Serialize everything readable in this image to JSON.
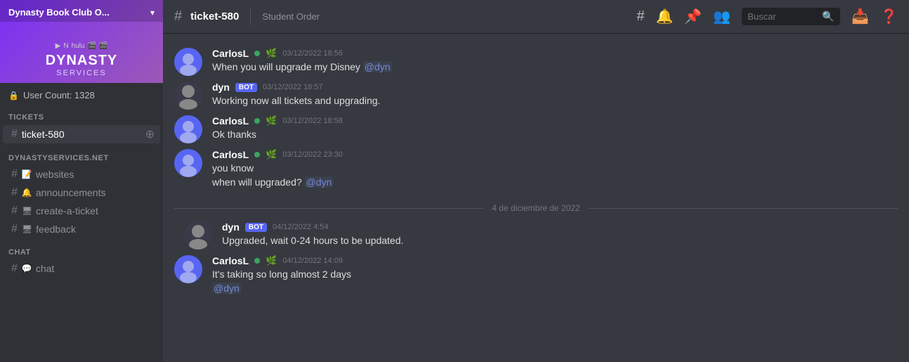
{
  "server": {
    "name": "Dynasty Book Club O...",
    "brand": "DYNASTY",
    "sub": "SERVICES",
    "logos": "🎬 N hulu 🎬 🎬",
    "user_count_label": "User Count: 1328"
  },
  "sidebar": {
    "sections": [
      {
        "label": "TICKETS",
        "channels": [
          {
            "id": "ticket-580",
            "name": "ticket-580",
            "emoji": "",
            "active": true
          }
        ]
      },
      {
        "label": "DYNASTYSERVICES.NET",
        "channels": [
          {
            "id": "websites",
            "name": "websites",
            "emoji": "📝"
          },
          {
            "id": "announcements",
            "name": "announcements",
            "emoji": "🔔"
          },
          {
            "id": "create-a-ticket",
            "name": "create-a-ticket",
            "emoji": "🖥"
          },
          {
            "id": "feedback",
            "name": "feedback",
            "emoji": "🖥"
          }
        ]
      },
      {
        "label": "CHAT",
        "channels": [
          {
            "id": "chat",
            "name": "chat",
            "emoji": "💬"
          }
        ]
      }
    ]
  },
  "topbar": {
    "channel": "ticket-580",
    "subtitle": "Student Order",
    "search_placeholder": "Buscar"
  },
  "messages": [
    {
      "id": "msg1",
      "author": "CarlosL",
      "author_type": "carlosl",
      "status": "online",
      "boost": true,
      "timestamp": "03/12/2022 18:56",
      "lines": [
        "When you will upgrade my Disney @dyn"
      ],
      "mention": "@dyn"
    },
    {
      "id": "msg2",
      "author": "dyn",
      "author_type": "dyn",
      "status": "online",
      "badge": "BOT",
      "timestamp": "03/12/2022 18:57",
      "lines": [
        "Working now all tickets and upgrading."
      ],
      "mention": ""
    },
    {
      "id": "msg3",
      "author": "CarlosL",
      "author_type": "carlosl",
      "status": "online",
      "boost": true,
      "timestamp": "03/12/2022 18:58",
      "lines": [
        "Ok thanks"
      ],
      "mention": ""
    },
    {
      "id": "msg4",
      "author": "CarlosL",
      "author_type": "carlosl",
      "status": "online",
      "boost": true,
      "timestamp": "03/12/2022 23:30",
      "lines": [
        "you know",
        "when will upgraded? @dyn"
      ],
      "mention": "@dyn"
    }
  ],
  "date_divider": "4 de diciembre de 2022",
  "messages2": [
    {
      "id": "msg5",
      "author": "dyn",
      "author_type": "dyn",
      "status": "online",
      "badge": "BOT",
      "timestamp": "04/12/2022 4:54",
      "lines": [
        "Upgraded, wait 0-24 hours to be updated."
      ],
      "mention": ""
    },
    {
      "id": "msg6",
      "author": "CarlosL",
      "author_type": "carlosl",
      "status": "online",
      "boost": true,
      "timestamp": "04/12/2022 14:09",
      "lines": [
        "It's taking so long almost 2 days",
        "@dyn"
      ],
      "mention": "@dyn"
    }
  ],
  "icons": {
    "hash": "#",
    "lock": "🔒",
    "chevron_down": "▾",
    "add": "⊕",
    "bell": "🔔",
    "pin": "📌",
    "people": "👥",
    "search": "🔍",
    "inbox": "📥",
    "help": "❓",
    "reply": "↩",
    "play": "◀",
    "link": "🔗",
    "id": "ID"
  }
}
